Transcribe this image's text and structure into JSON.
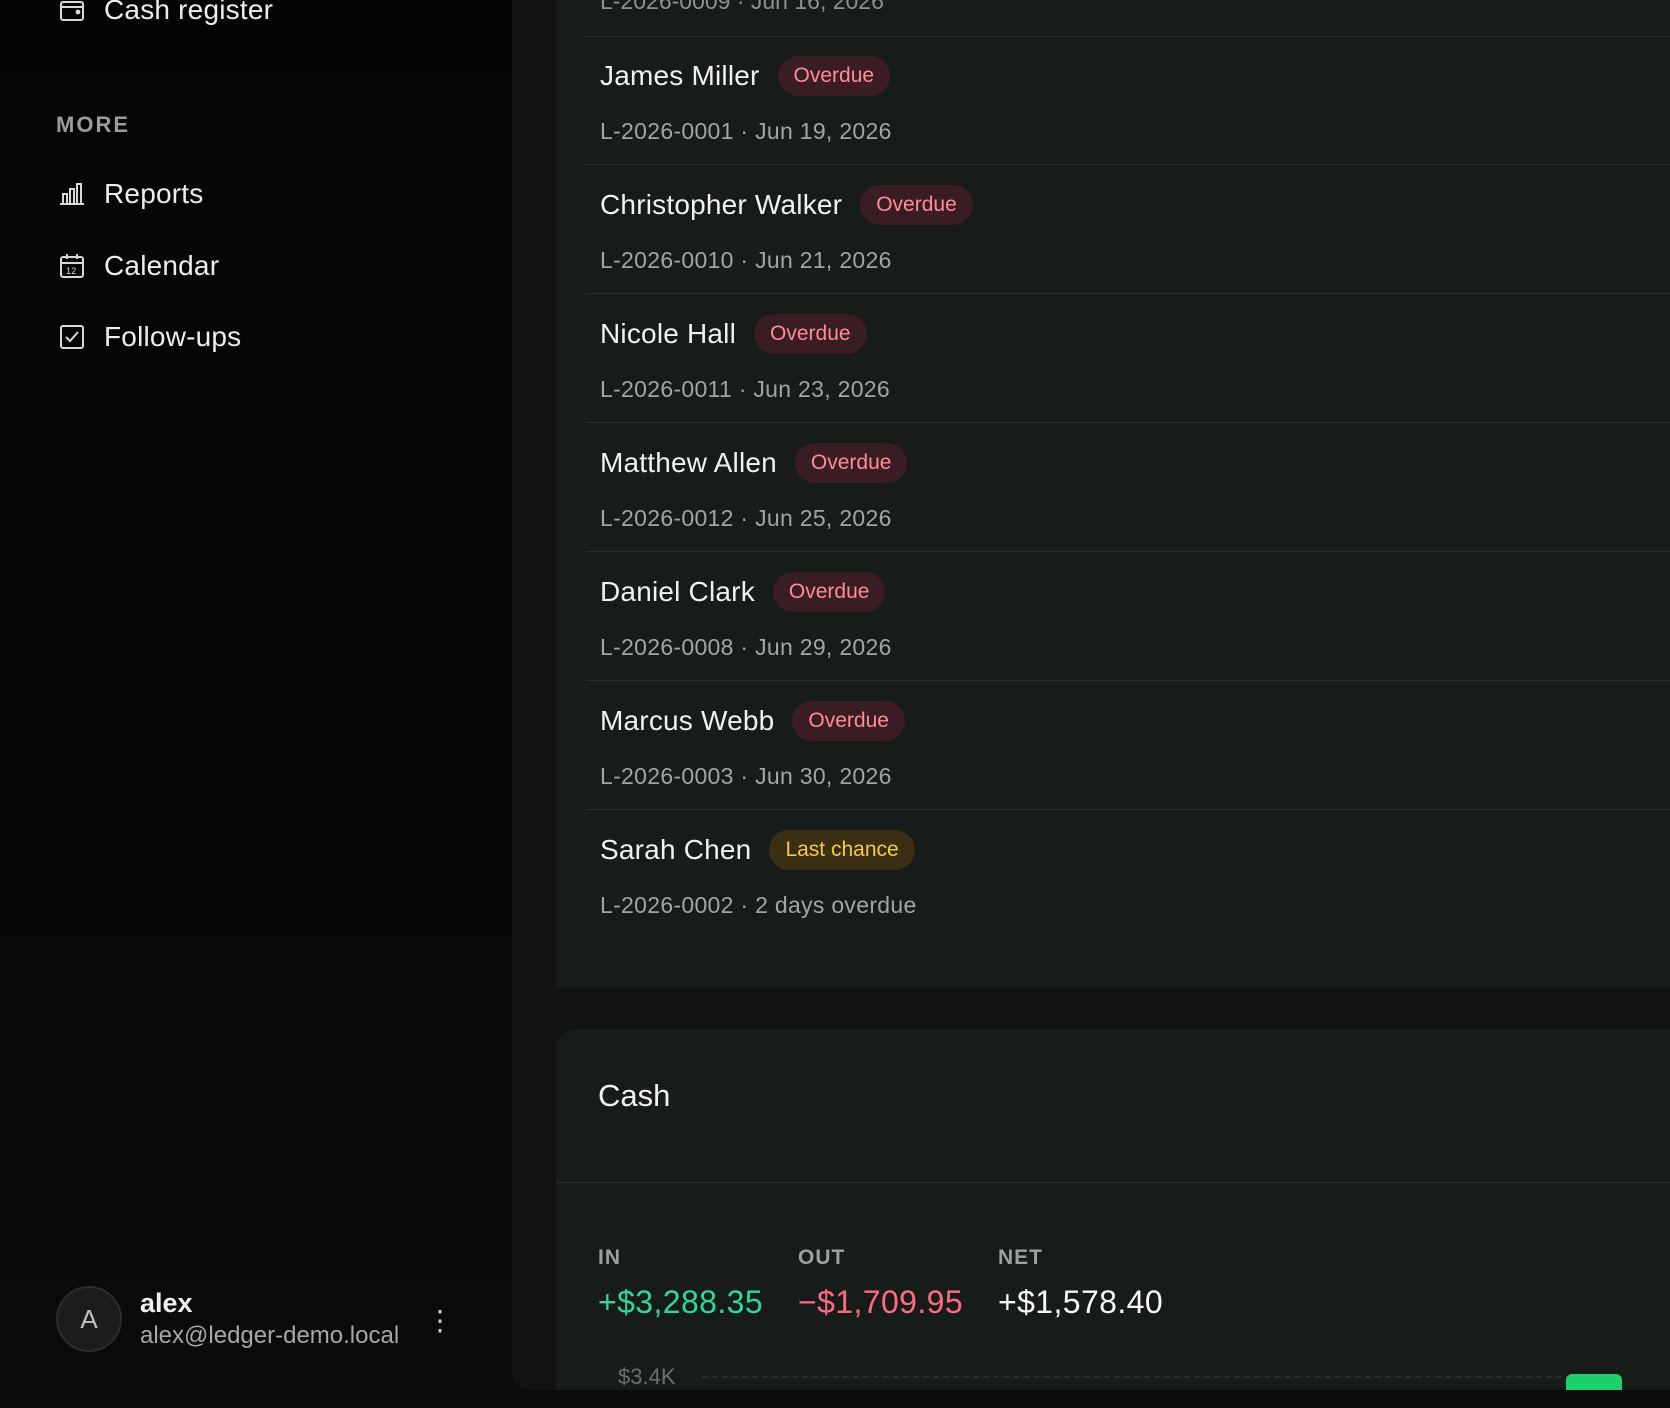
{
  "sidebar": {
    "top_item": {
      "label": "Cash register",
      "icon": "wallet-icon"
    },
    "section_title": "MORE",
    "items": [
      {
        "label": "Reports",
        "icon": "bar-chart-icon"
      },
      {
        "label": "Calendar",
        "icon": "calendar-icon"
      },
      {
        "label": "Follow-ups",
        "icon": "checkbox-icon"
      }
    ],
    "user": {
      "initial": "A",
      "name": "alex",
      "email": "alex@ledger-demo.local",
      "menu_glyph": "⋮"
    }
  },
  "list": {
    "partial_row_text": "L-2026-0009 · Jun 16, 2026",
    "rows": [
      {
        "name": "James Miller",
        "badge": "Overdue",
        "badge_type": "overdue",
        "sub": "L-2026-0001 · Jun 19, 2026"
      },
      {
        "name": "Christopher Walker",
        "badge": "Overdue",
        "badge_type": "overdue",
        "sub": "L-2026-0010 · Jun 21, 2026"
      },
      {
        "name": "Nicole Hall",
        "badge": "Overdue",
        "badge_type": "overdue",
        "sub": "L-2026-0011 · Jun 23, 2026"
      },
      {
        "name": "Matthew Allen",
        "badge": "Overdue",
        "badge_type": "overdue",
        "sub": "L-2026-0012 · Jun 25, 2026"
      },
      {
        "name": "Daniel Clark",
        "badge": "Overdue",
        "badge_type": "overdue",
        "sub": "L-2026-0008 · Jun 29, 2026"
      },
      {
        "name": "Marcus Webb",
        "badge": "Overdue",
        "badge_type": "overdue",
        "sub": "L-2026-0003 · Jun 30, 2026"
      },
      {
        "name": "Sarah Chen",
        "badge": "Last chance",
        "badge_type": "last",
        "sub": "L-2026-0002 · 2 days overdue"
      }
    ]
  },
  "cash": {
    "title": "Cash",
    "in_label": "IN",
    "in_value": "+$3,288.35",
    "out_label": "OUT",
    "out_value": "−$1,709.95",
    "net_label": "NET",
    "net_value": "+$1,578.40",
    "chart_tick": "$3.4K"
  },
  "colors": {
    "in": "#2ed89a",
    "out": "#ff6b7e",
    "overdue_badge_text": "#ff8a9a",
    "last_chance_badge_text": "#f4c94b",
    "chart_bar": "#1fcf6b"
  }
}
